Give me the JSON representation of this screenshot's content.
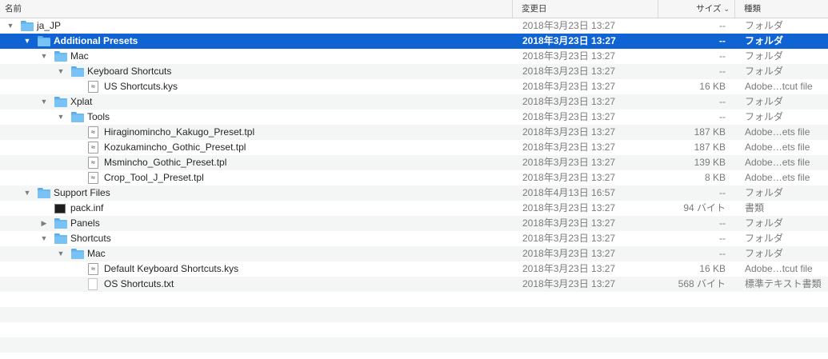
{
  "columns": {
    "name": "名前",
    "date": "変更日",
    "size": "サイズ",
    "kind": "種類",
    "size_sort": "⌄"
  },
  "rows": [
    {
      "name": "ja_JP",
      "date": "2018年3月23日 13:27",
      "size": "--",
      "kind": "フォルダ",
      "icon": "folder-icon",
      "arrow": "▼",
      "depth": 0,
      "selected": false
    },
    {
      "name": "Additional Presets",
      "date": "2018年3月23日 13:27",
      "size": "--",
      "kind": "フォルダ",
      "icon": "folder-icon",
      "arrow": "▼",
      "depth": 1,
      "selected": true
    },
    {
      "name": "Mac",
      "date": "2018年3月23日 13:27",
      "size": "--",
      "kind": "フォルダ",
      "icon": "folder-icon",
      "arrow": "▼",
      "depth": 2,
      "selected": false
    },
    {
      "name": "Keyboard Shortcuts",
      "date": "2018年3月23日 13:27",
      "size": "--",
      "kind": "フォルダ",
      "icon": "folder-icon",
      "arrow": "▼",
      "depth": 3,
      "selected": false
    },
    {
      "name": "US Shortcuts.kys",
      "date": "2018年3月23日 13:27",
      "size": "16 KB",
      "kind": "Adobe…tcut file",
      "icon": "document-icon",
      "arrow": "",
      "depth": 4,
      "selected": false
    },
    {
      "name": "Xplat",
      "date": "2018年3月23日 13:27",
      "size": "--",
      "kind": "フォルダ",
      "icon": "folder-icon",
      "arrow": "▼",
      "depth": 2,
      "selected": false
    },
    {
      "name": "Tools",
      "date": "2018年3月23日 13:27",
      "size": "--",
      "kind": "フォルダ",
      "icon": "folder-icon",
      "arrow": "▼",
      "depth": 3,
      "selected": false
    },
    {
      "name": "Hiraginomincho_Kakugo_Preset.tpl",
      "date": "2018年3月23日 13:27",
      "size": "187 KB",
      "kind": "Adobe…ets file",
      "icon": "document-icon",
      "arrow": "",
      "depth": 4,
      "selected": false
    },
    {
      "name": "Kozukamincho_Gothic_Preset.tpl",
      "date": "2018年3月23日 13:27",
      "size": "187 KB",
      "kind": "Adobe…ets file",
      "icon": "document-icon",
      "arrow": "",
      "depth": 4,
      "selected": false
    },
    {
      "name": "Msmincho_Gothic_Preset.tpl",
      "date": "2018年3月23日 13:27",
      "size": "139 KB",
      "kind": "Adobe…ets file",
      "icon": "document-icon",
      "arrow": "",
      "depth": 4,
      "selected": false
    },
    {
      "name": "Crop_Tool_J_Preset.tpl",
      "date": "2018年3月23日 13:27",
      "size": "8 KB",
      "kind": "Adobe…ets file",
      "icon": "document-icon",
      "arrow": "",
      "depth": 4,
      "selected": false
    },
    {
      "name": "Support Files",
      "date": "2018年4月13日 16:57",
      "size": "--",
      "kind": "フォルダ",
      "icon": "folder-icon",
      "arrow": "▼",
      "depth": 1,
      "selected": false
    },
    {
      "name": "pack.inf",
      "date": "2018年3月23日 13:27",
      "size": "94 バイト",
      "kind": "書類",
      "icon": "terminal-icon",
      "arrow": "",
      "depth": 2,
      "selected": false
    },
    {
      "name": "Panels",
      "date": "2018年3月23日 13:27",
      "size": "--",
      "kind": "フォルダ",
      "icon": "folder-icon",
      "arrow": "▶",
      "depth": 2,
      "selected": false
    },
    {
      "name": "Shortcuts",
      "date": "2018年3月23日 13:27",
      "size": "--",
      "kind": "フォルダ",
      "icon": "folder-icon",
      "arrow": "▼",
      "depth": 2,
      "selected": false
    },
    {
      "name": "Mac",
      "date": "2018年3月23日 13:27",
      "size": "--",
      "kind": "フォルダ",
      "icon": "folder-icon",
      "arrow": "▼",
      "depth": 3,
      "selected": false
    },
    {
      "name": "Default Keyboard Shortcuts.kys",
      "date": "2018年3月23日 13:27",
      "size": "16 KB",
      "kind": "Adobe…tcut file",
      "icon": "document-icon",
      "arrow": "",
      "depth": 4,
      "selected": false
    },
    {
      "name": "OS Shortcuts.txt",
      "date": "2018年3月23日 13:27",
      "size": "568 バイト",
      "kind": "標準テキスト書類",
      "icon": "text-file-icon",
      "arrow": "",
      "depth": 4,
      "selected": false
    }
  ],
  "empty_rows": 4,
  "colors": {
    "selection": "#0f63d2",
    "alternate_row": "#f4f5f5",
    "folder": "#6ab8f0"
  }
}
